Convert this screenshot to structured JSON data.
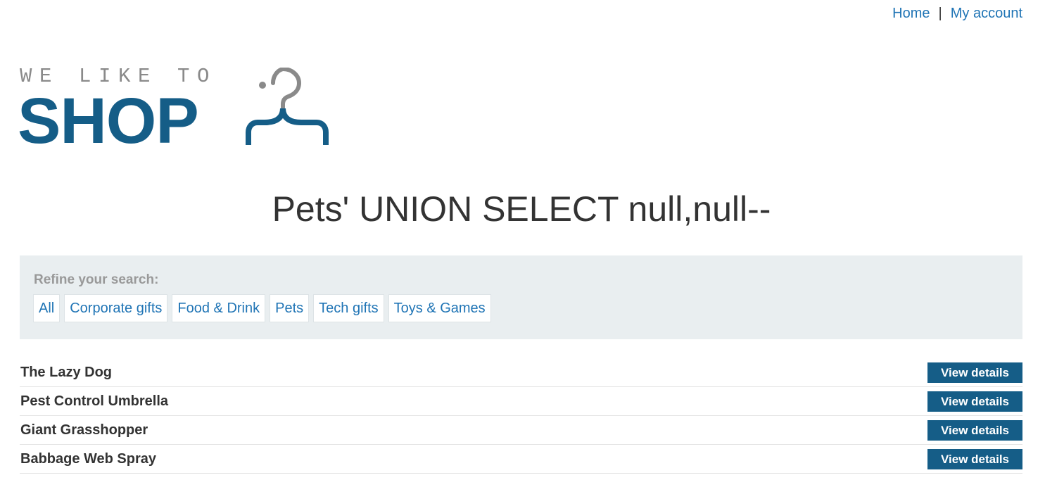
{
  "nav": {
    "home_label": "Home",
    "separator": "|",
    "account_label": "My account"
  },
  "logo": {
    "top_text": "WE LIKE TO",
    "bottom_text": "SHOP",
    "icon": "hanger-icon",
    "colors": {
      "primary": "#155d87",
      "secondary": "#8a8a8a"
    }
  },
  "page": {
    "title": "Pets' UNION SELECT null,null--"
  },
  "filters": {
    "label": "Refine your search:",
    "items": [
      "All",
      "Corporate gifts",
      "Food & Drink",
      "Pets",
      "Tech gifts",
      "Toys & Games"
    ]
  },
  "products": [
    {
      "name": "The Lazy Dog",
      "button": "View details"
    },
    {
      "name": "Pest Control Umbrella",
      "button": "View details"
    },
    {
      "name": "Giant Grasshopper",
      "button": "View details"
    },
    {
      "name": "Babbage Web Spray",
      "button": "View details"
    }
  ],
  "colors": {
    "link": "#1f74b5",
    "button": "#155d87",
    "panel": "#e9eef0"
  }
}
